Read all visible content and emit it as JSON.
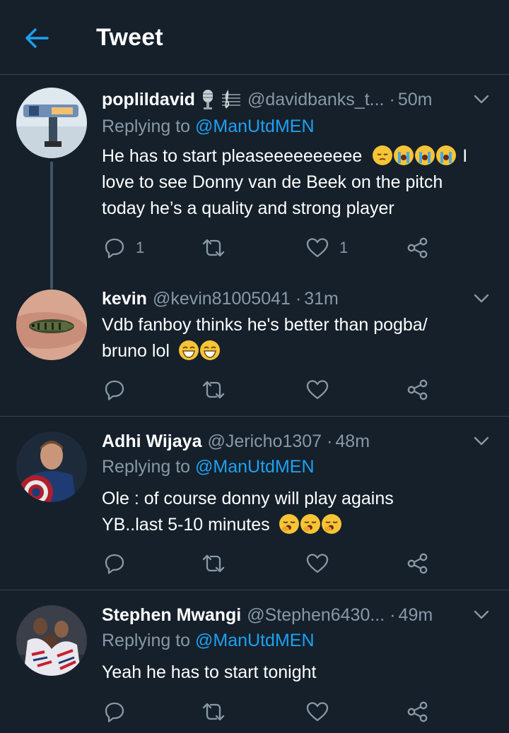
{
  "header": {
    "title": "Tweet"
  },
  "colors": {
    "background": "#15202b",
    "divider": "#38444d",
    "secondary_text": "#8899a6",
    "accent": "#1da1f2"
  },
  "tweets": [
    {
      "name": "poplildavid",
      "handle": "@davidbanks_t...",
      "time": "50m",
      "replying_label": "Replying to",
      "replying_to": "@ManUtdMEN",
      "text_1": "He has to start pleaseeeeeeeeee",
      "text_2": "I love to see Donny van de Beek on the pitch today he’s a quality and strong player",
      "reply_count": "1",
      "like_count": "1"
    },
    {
      "name": "kevin",
      "handle": "@kevin81005041",
      "time": "31m",
      "text_1": "Vdb fanboy thinks he's better than pogba/ bruno lol",
      "reply_count": "",
      "like_count": ""
    },
    {
      "name": "Adhi Wijaya",
      "handle": "@Jericho1307",
      "time": "48m",
      "replying_label": "Replying to",
      "replying_to": "@ManUtdMEN",
      "text_1": "Ole : of course donny will play agains YB..last 5-10 minutes",
      "reply_count": "",
      "like_count": ""
    },
    {
      "name": "Stephen Mwangi",
      "handle": "@Stephen6430...",
      "time": "49m",
      "replying_label": "Replying to",
      "replying_to": "@ManUtdMEN",
      "text_1": "Yeah he has to start tonight",
      "reply_count": "",
      "like_count": ""
    }
  ]
}
